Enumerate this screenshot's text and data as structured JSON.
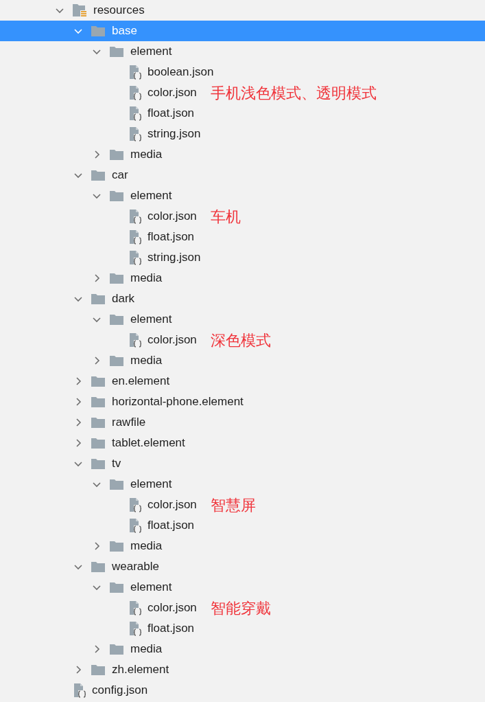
{
  "tree": [
    {
      "label": "resources",
      "kind": "resources",
      "expanded": true,
      "selected": false,
      "children": [
        {
          "label": "base",
          "kind": "folder",
          "expanded": true,
          "selected": true,
          "children": [
            {
              "label": "element",
              "kind": "folder",
              "expanded": true,
              "selected": false,
              "children": [
                {
                  "label": "boolean.json",
                  "kind": "file",
                  "selected": false
                },
                {
                  "label": "color.json",
                  "kind": "file",
                  "selected": false,
                  "note": "手机浅色模式、透明模式"
                },
                {
                  "label": "float.json",
                  "kind": "file",
                  "selected": false
                },
                {
                  "label": "string.json",
                  "kind": "file",
                  "selected": false
                }
              ]
            },
            {
              "label": "media",
              "kind": "folder",
              "expanded": false,
              "selected": false
            }
          ]
        },
        {
          "label": "car",
          "kind": "folder",
          "expanded": true,
          "selected": false,
          "children": [
            {
              "label": "element",
              "kind": "folder",
              "expanded": true,
              "selected": false,
              "children": [
                {
                  "label": "color.json",
                  "kind": "file",
                  "selected": false,
                  "note": "车机"
                },
                {
                  "label": "float.json",
                  "kind": "file",
                  "selected": false
                },
                {
                  "label": "string.json",
                  "kind": "file",
                  "selected": false
                }
              ]
            },
            {
              "label": "media",
              "kind": "folder",
              "expanded": false,
              "selected": false
            }
          ]
        },
        {
          "label": "dark",
          "kind": "folder",
          "expanded": true,
          "selected": false,
          "children": [
            {
              "label": "element",
              "kind": "folder",
              "expanded": true,
              "selected": false,
              "children": [
                {
                  "label": "color.json",
                  "kind": "file",
                  "selected": false,
                  "note": "深色模式"
                }
              ]
            },
            {
              "label": "media",
              "kind": "folder",
              "expanded": false,
              "selected": false
            }
          ]
        },
        {
          "label": "en.element",
          "kind": "folder",
          "expanded": false,
          "selected": false
        },
        {
          "label": "horizontal-phone.element",
          "kind": "folder",
          "expanded": false,
          "selected": false
        },
        {
          "label": "rawfile",
          "kind": "folder",
          "expanded": false,
          "selected": false
        },
        {
          "label": "tablet.element",
          "kind": "folder",
          "expanded": false,
          "selected": false
        },
        {
          "label": "tv",
          "kind": "folder",
          "expanded": true,
          "selected": false,
          "children": [
            {
              "label": "element",
              "kind": "folder",
              "expanded": true,
              "selected": false,
              "children": [
                {
                  "label": "color.json",
                  "kind": "file",
                  "selected": false,
                  "note": "智慧屏"
                },
                {
                  "label": "float.json",
                  "kind": "file",
                  "selected": false
                }
              ]
            },
            {
              "label": "media",
              "kind": "folder",
              "expanded": false,
              "selected": false
            }
          ]
        },
        {
          "label": "wearable",
          "kind": "folder",
          "expanded": true,
          "selected": false,
          "children": [
            {
              "label": "element",
              "kind": "folder",
              "expanded": true,
              "selected": false,
              "children": [
                {
                  "label": "color.json",
                  "kind": "file",
                  "selected": false,
                  "note": "智能穿戴"
                },
                {
                  "label": "float.json",
                  "kind": "file",
                  "selected": false
                }
              ]
            },
            {
              "label": "media",
              "kind": "folder",
              "expanded": false,
              "selected": false
            }
          ]
        },
        {
          "label": "zh.element",
          "kind": "folder",
          "expanded": false,
          "selected": false
        }
      ]
    },
    {
      "label": "config.json",
      "kind": "file",
      "selected": false
    }
  ]
}
